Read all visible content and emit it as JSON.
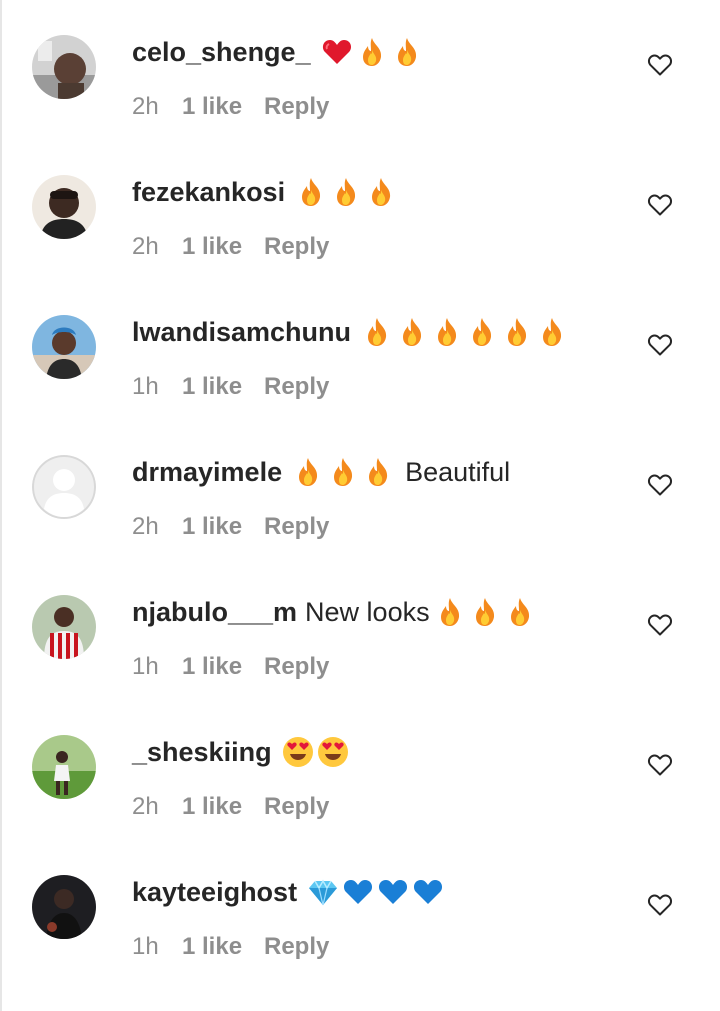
{
  "comments": [
    {
      "username": "celo_shenge_",
      "emoji": [
        "red-heart",
        "fire",
        "fire"
      ],
      "text": "",
      "time": "2h",
      "likes": "1 like",
      "reply": "Reply",
      "avatar_bg": "#cfcfcf"
    },
    {
      "username": "fezekankosi",
      "emoji": [
        "fire",
        "fire",
        "fire"
      ],
      "text": "",
      "time": "2h",
      "likes": "1 like",
      "reply": "Reply",
      "avatar_bg": "#e9e3db"
    },
    {
      "username": "lwandisamchunu",
      "emoji": [
        "fire",
        "fire",
        "fire",
        "fire",
        "fire",
        "fire"
      ],
      "text": "",
      "time": "1h",
      "likes": "1 like",
      "reply": "Reply",
      "avatar_bg": "#6aa8d6"
    },
    {
      "username": "drmayimele",
      "emoji": [
        "fire",
        "fire",
        "fire"
      ],
      "text": "Beautiful",
      "time": "2h",
      "likes": "1 like",
      "reply": "Reply",
      "avatar_bg": "#efefef"
    },
    {
      "username": "njabulo___m",
      "emoji_after_text": [
        "fire",
        "fire",
        "fire"
      ],
      "text": "New looks",
      "time": "1h",
      "likes": "1 like",
      "reply": "Reply",
      "avatar_bg": "#c9d7c0"
    },
    {
      "username": "_sheskiing",
      "emoji": [
        "heart-eyes",
        "heart-eyes"
      ],
      "text": "",
      "time": "2h",
      "likes": "1 like",
      "reply": "Reply",
      "avatar_bg": "#5f9a3a"
    },
    {
      "username": "kayteeighost",
      "emoji": [
        "gem-stone",
        "blue-heart",
        "blue-heart",
        "blue-heart"
      ],
      "text": "",
      "time": "1h",
      "likes": "1 like",
      "reply": "Reply",
      "avatar_bg": "#1e1e22"
    }
  ],
  "colors": {
    "text": "#262626",
    "meta": "#8e8e8e",
    "heart_outline": "#262626"
  },
  "icons": {
    "like": "heart-outline-icon"
  }
}
